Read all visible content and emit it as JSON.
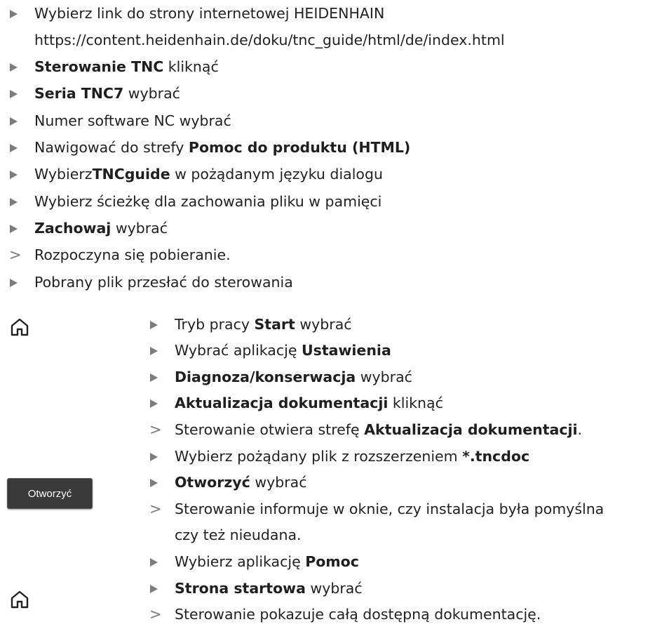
{
  "steps_top": [
    {
      "marker": "arrow",
      "parts": [
        {
          "t": "Wybierz link do strony internetowej HEIDENHAIN",
          "b": false
        }
      ]
    },
    {
      "marker": "none",
      "parts": [
        {
          "t": "https://content.heidenhain.de/doku/tnc_guide/html/de/index.html",
          "b": false
        }
      ]
    },
    {
      "marker": "arrow",
      "parts": [
        {
          "t": "Sterowanie TNC",
          "b": true
        },
        {
          "t": " kliknąć",
          "b": false
        }
      ]
    },
    {
      "marker": "arrow",
      "parts": [
        {
          "t": "Seria TNC7",
          "b": true
        },
        {
          "t": " wybrać",
          "b": false
        }
      ]
    },
    {
      "marker": "arrow",
      "parts": [
        {
          "t": "Numer software NC wybrać",
          "b": false
        }
      ]
    },
    {
      "marker": "arrow",
      "parts": [
        {
          "t": "Nawigować do strefy ",
          "b": false
        },
        {
          "t": "Pomoc do produktu (HTML)",
          "b": true
        }
      ]
    },
    {
      "marker": "arrow",
      "parts": [
        {
          "t": "Wybierz",
          "b": false
        },
        {
          "t": "TNCguide",
          "b": true
        },
        {
          "t": " w pożądanym języku dialogu",
          "b": false
        }
      ]
    },
    {
      "marker": "arrow",
      "parts": [
        {
          "t": "Wybierz ścieżkę dla zachowania pliku w pamięci",
          "b": false
        }
      ]
    },
    {
      "marker": "arrow",
      "parts": [
        {
          "t": "Zachowaj",
          "b": true
        },
        {
          "t": " wybrać",
          "b": false
        }
      ]
    },
    {
      "marker": "result",
      "parts": [
        {
          "t": "Rozpoczyna się pobieranie.",
          "b": false
        }
      ]
    },
    {
      "marker": "arrow",
      "parts": [
        {
          "t": "Pobrany plik przesłać do sterowania",
          "b": false
        }
      ]
    }
  ],
  "steps_sub": [
    {
      "marker": "arrow",
      "parts": [
        {
          "t": "Tryb pracy ",
          "b": false
        },
        {
          "t": "Start",
          "b": true
        },
        {
          "t": " wybrać",
          "b": false
        }
      ]
    },
    {
      "marker": "arrow",
      "parts": [
        {
          "t": "Wybrać aplikację ",
          "b": false
        },
        {
          "t": "Ustawienia",
          "b": true
        }
      ]
    },
    {
      "marker": "arrow",
      "parts": [
        {
          "t": "Diagnoza/konserwacja",
          "b": true
        },
        {
          "t": " wybrać",
          "b": false
        }
      ]
    },
    {
      "marker": "arrow",
      "parts": [
        {
          "t": "Aktualizacja dokumentacji",
          "b": true
        },
        {
          "t": " kliknąć",
          "b": false
        }
      ]
    },
    {
      "marker": "result",
      "parts": [
        {
          "t": "Sterowanie otwiera strefę ",
          "b": false
        },
        {
          "t": "Aktualizacja dokumentacji",
          "b": true
        },
        {
          "t": ".",
          "b": false
        }
      ]
    },
    {
      "marker": "arrow",
      "parts": [
        {
          "t": "Wybierz pożądany plik z rozszerzeniem ",
          "b": false
        },
        {
          "t": "*.tncdoc",
          "b": true
        }
      ]
    },
    {
      "marker": "arrow",
      "parts": [
        {
          "t": "Otworzyć",
          "b": true
        },
        {
          "t": " wybrać",
          "b": false
        }
      ]
    },
    {
      "marker": "result",
      "parts": [
        {
          "t": "Sterowanie informuje w oknie, czy instalacja była pomyślna",
          "b": false
        }
      ]
    },
    {
      "marker": "none",
      "parts": [
        {
          "t": "czy też nieudana.",
          "b": false
        }
      ]
    },
    {
      "marker": "arrow",
      "parts": [
        {
          "t": "Wybierz aplikację ",
          "b": false
        },
        {
          "t": "Pomoc",
          "b": true
        }
      ]
    },
    {
      "marker": "arrow",
      "parts": [
        {
          "t": "Strona startowa",
          "b": true
        },
        {
          "t": " wybrać",
          "b": false
        }
      ]
    },
    {
      "marker": "result",
      "parts": [
        {
          "t": "Sterowanie pokazuje całą dostępną dokumentację.",
          "b": false
        }
      ]
    }
  ],
  "side": {
    "open_button_label": "Otworzyć",
    "icons": [
      "home-icon",
      "home-icon"
    ]
  }
}
